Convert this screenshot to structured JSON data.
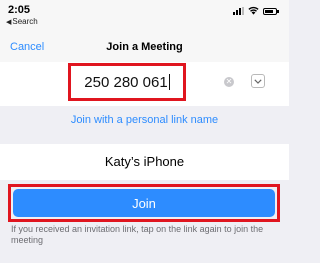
{
  "status_bar": {
    "time": "2:05",
    "back_app": "Search"
  },
  "nav": {
    "cancel": "Cancel",
    "title": "Join a Meeting"
  },
  "meeting_id_field": {
    "value": "250 280 061"
  },
  "personal_link": "Join with a personal link name",
  "device_name": "Katy’s iPhone",
  "join_button": "Join",
  "help_text": "If you received an invitation link, tap on the link again to join the meeting",
  "colors": {
    "accent": "#2d8cff",
    "highlight": "#e0151f"
  }
}
